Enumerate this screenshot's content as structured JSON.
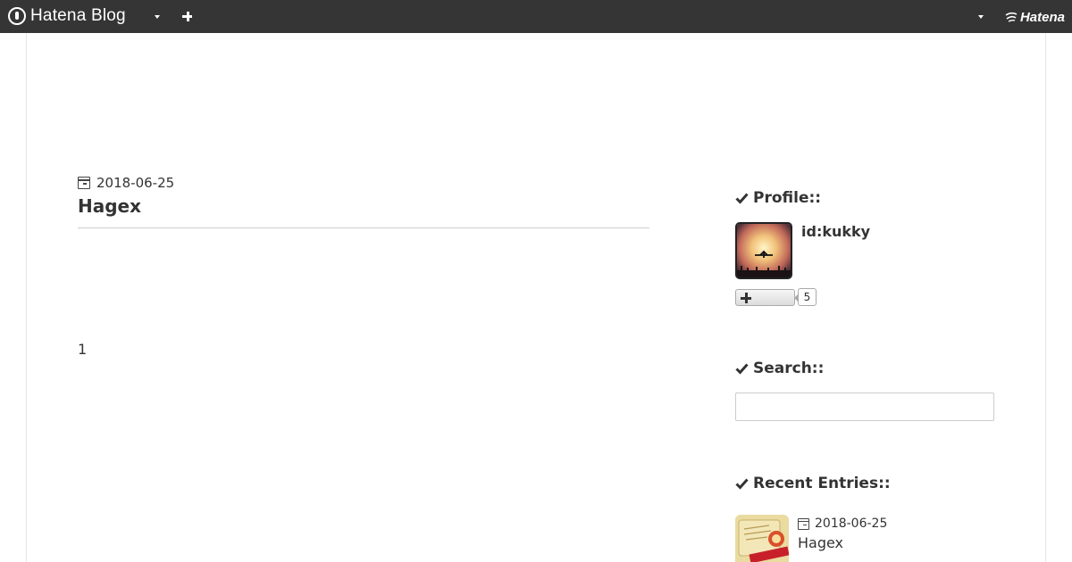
{
  "globalbar": {
    "logo_text": "Hatena Blog",
    "brand_text": "Hatena",
    "background": "#353535"
  },
  "entry": {
    "date": "2018-06-25",
    "title": "Hagex",
    "body": "1"
  },
  "sidebar": {
    "profile": {
      "heading": "Profile::",
      "user_id": "id:kukky",
      "subscriber_count": "5"
    },
    "search": {
      "heading": "Search::",
      "value": "",
      "placeholder": ""
    },
    "recent": {
      "heading": "Recent Entries::",
      "items": [
        {
          "date": "2018-06-25",
          "title": "Hagex"
        }
      ]
    }
  }
}
